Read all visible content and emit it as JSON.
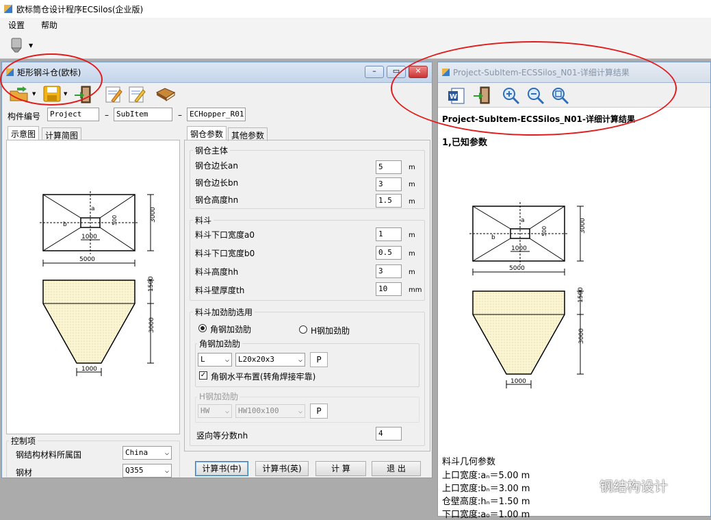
{
  "app": {
    "title": "欧标筒仓设计程序ECSilos(企业版)"
  },
  "menu": [
    "设置",
    "帮助"
  ],
  "child_left": {
    "title": "矩形钢斗仓(欧标)",
    "window_buttons": [
      "–",
      "▭",
      "✕"
    ],
    "id_label": "构件编号",
    "id_values": [
      "Project",
      "SubItem",
      "ECHopper_R01"
    ],
    "id_sep": "–",
    "left_tabs": [
      "示意图",
      "计算简图"
    ],
    "right_tabs": [
      "钢仓参数",
      "其他参数"
    ],
    "diagram": {
      "a_label": "a",
      "b_label": "b",
      "dim_1000": "1000",
      "dim_500": "500",
      "dim_5000": "5000",
      "dim_3000": "3000",
      "dim_1500": "1500"
    },
    "group_body": {
      "title": "钢仓主体",
      "rows": [
        {
          "label": "钢仓边长an",
          "value": "5",
          "unit": "m"
        },
        {
          "label": "钢仓边长bn",
          "value": "3",
          "unit": "m"
        },
        {
          "label": "钢仓高度hn",
          "value": "1.5",
          "unit": "m"
        }
      ]
    },
    "group_hopper": {
      "title": "料斗",
      "rows": [
        {
          "label": "料斗下口宽度a0",
          "value": "1",
          "unit": "m"
        },
        {
          "label": "料斗下口宽度b0",
          "value": "0.5",
          "unit": "m"
        },
        {
          "label": "料斗高度hh",
          "value": "3",
          "unit": "m"
        },
        {
          "label": "料斗壁厚度th",
          "value": "10",
          "unit": "mm"
        }
      ]
    },
    "group_stiff": {
      "title": "料斗加劲肋选用",
      "radio1": "角钢加劲肋",
      "radio2": "H钢加劲肋",
      "angle_title": "角钢加劲肋",
      "angle_type": "L",
      "angle_size": "L20x20x3",
      "p_btn": "P",
      "checkbox": "角钢水平布置(转角焊接牢靠)",
      "h_title": "H钢加劲肋",
      "h_type": "HW",
      "h_size": "HW100x100",
      "div_label": "竖向等分数nh",
      "div_value": "4"
    },
    "control": {
      "title": "控制项",
      "country_label": "钢结构材料所属国",
      "country_value": "China",
      "steel_label": "钢材",
      "steel_value": "Q355"
    },
    "buttons": [
      "计算书(中)",
      "计算书(英)",
      "计 算",
      "退 出"
    ]
  },
  "child_right": {
    "title": "Project-SubItem-ECSSilos_N01-详细计算结果",
    "heading": "Project-SubItem-ECSSilos_N01-详细计算结果",
    "section1": "1,已知参数",
    "geo_title": "料斗几何参数",
    "geo_rows": [
      "上口宽度:aₙ＝5.00 m",
      "上口宽度:bₙ＝3.00 m",
      "仓壁高度:hₙ＝1.50 m",
      "下口宽度:a₀＝1.00 m"
    ]
  },
  "watermark": "钢结构设计",
  "colors": {
    "highlight": "#e21b1b",
    "hopper_fill": "#fbf5d3"
  }
}
